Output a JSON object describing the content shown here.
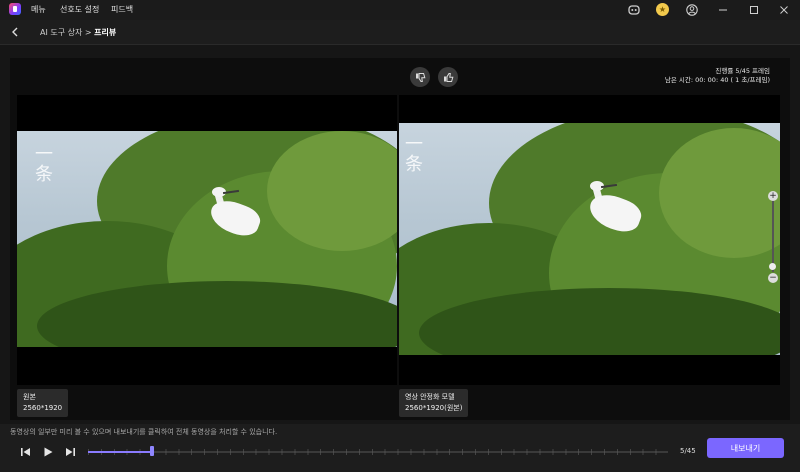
{
  "menu": {
    "items": [
      "메뉴",
      "선호도 설정",
      "피드백"
    ]
  },
  "breadcrumb": {
    "parent": "AI 도구 상자",
    "separator": ">",
    "current": "프리뷰"
  },
  "preview": {
    "left_label": {
      "title": "원본",
      "resolution": "2560*1920"
    },
    "right_label": {
      "title": "영상 안정화 모델",
      "resolution": "2560*1920(원본)"
    },
    "watermark": "一\n条",
    "status_line1": "진행률 5/45 프레임",
    "status_line2": "남은 시간: 00: 00: 40 ( 1 초/프레임)"
  },
  "footer": {
    "hint": "동영상의 일부만 미리 볼 수 있으며 내보내기를 클릭하여 전체 동영상을 처리할 수 있습니다.",
    "counter": "5/45",
    "export_label": "내보내기",
    "progress": 0.111
  },
  "icons": {
    "titlebar": [
      "discord-icon",
      "premium-icon",
      "account-icon",
      "minimize-icon",
      "maximize-icon",
      "close-icon"
    ]
  },
  "colors": {
    "accent": "#7b67ff",
    "background": "#161616"
  }
}
